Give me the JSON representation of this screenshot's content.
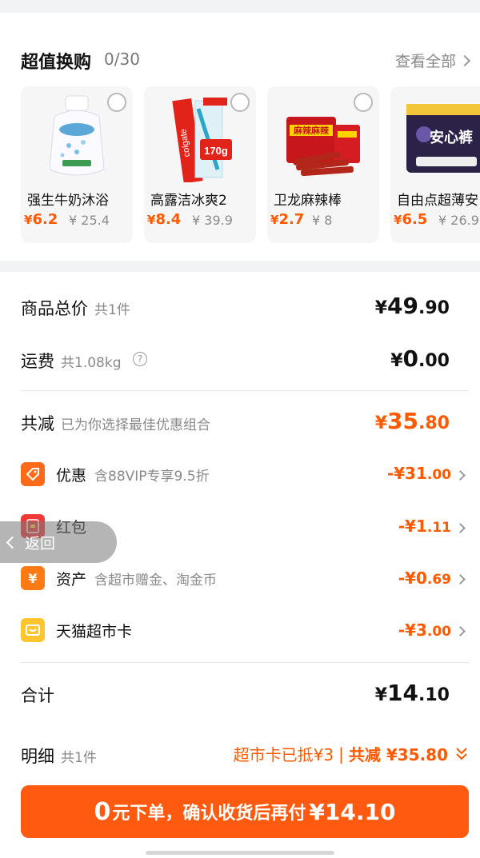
{
  "swap": {
    "title": "超值换购",
    "count": "0/30",
    "view_all": "查看全部",
    "products": [
      {
        "name": "强生牛奶沐浴",
        "price_sym": "¥",
        "price": "6.2",
        "orig": "¥ 25.4"
      },
      {
        "name": "高露洁冰爽2",
        "price_sym": "¥",
        "price": "8.4",
        "orig": "¥ 39.9"
      },
      {
        "name": "卫龙麻辣棒",
        "price_sym": "¥",
        "price": "2.7",
        "orig": "¥ 8"
      },
      {
        "name": "自由点超薄安",
        "price_sym": "¥",
        "price": "6.5",
        "orig": "¥ 26.9"
      }
    ],
    "product_text": {
      "toothpaste_badge": "170g",
      "toothpaste_brand": "colgate",
      "snack_brand": "麻辣麻辣",
      "pad_brand": "安心裤"
    }
  },
  "summary": {
    "goods_total": {
      "label": "商品总价",
      "sub": "共1件",
      "yen": "¥",
      "int": "49",
      "dec": ".90"
    },
    "shipping": {
      "label": "运费",
      "sub": "共1.08kg",
      "yen": "¥",
      "int": "0",
      "dec": ".00"
    },
    "discount": {
      "label": "共减",
      "sub": "已为你选择最佳优惠组合",
      "yen": "¥",
      "int": "35",
      "dec": ".80"
    },
    "items": [
      {
        "label": "优惠",
        "hint": "含88VIP专享9.5折",
        "value_main": "-¥31",
        "value_dec": ".00",
        "icon": "tag-icon",
        "color": "#ff6a1a",
        "chevron": true
      },
      {
        "label": "红包",
        "hint": "",
        "value_main": "-¥1",
        "value_dec": ".11",
        "icon": "red-packet-icon",
        "color": "#f03a3a",
        "chevron": true
      },
      {
        "label": "资产",
        "hint": "含超市赠金、淘金币",
        "value_main": "-¥0",
        "value_dec": ".69",
        "icon": "yen-asset-icon",
        "color": "#ff7a14",
        "chevron": true
      },
      {
        "label": "天猫超市卡",
        "hint": "",
        "value_main": "-¥3",
        "value_dec": ".00",
        "icon": "supermarket-card-icon",
        "color": "#ffc52e",
        "chevron": true
      }
    ],
    "total": {
      "label": "合计",
      "yen": "¥",
      "int": "14",
      "dec": ".10"
    },
    "detail": {
      "label": "明细",
      "sub": "共1件",
      "card_text": "超市卡已抵¥3",
      "sep": "|",
      "reduce_text": "共减 ¥35.80"
    }
  },
  "back_button": {
    "label": "返回"
  },
  "cta": {
    "zero": "0",
    "text": "元下单，确认收货后再付",
    "amount": "¥14.10"
  },
  "colors": {
    "accent": "#ff5a0f",
    "price": "#ff5a00",
    "muted": "#888888"
  }
}
